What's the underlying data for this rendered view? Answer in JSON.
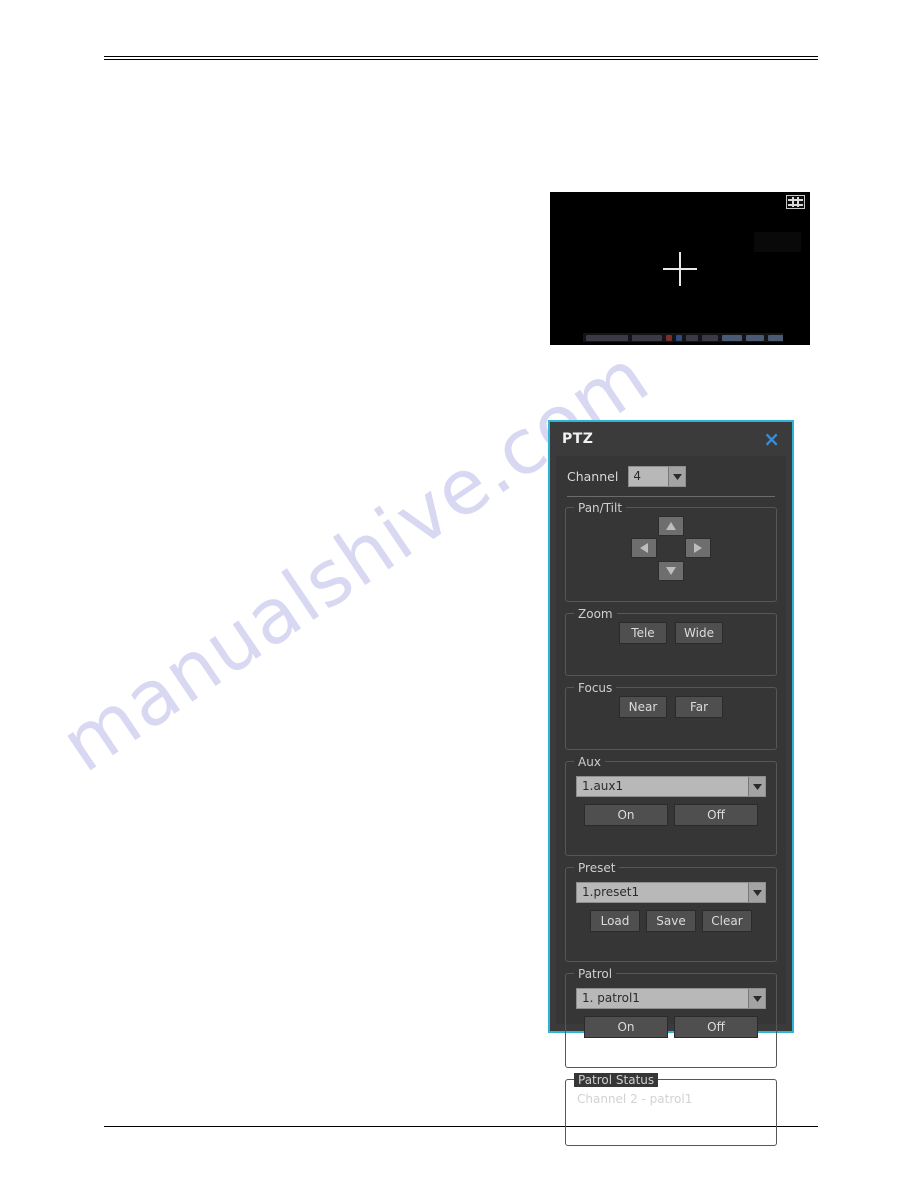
{
  "page": {
    "watermark_text": "manualshive.com",
    "accent_border_color": "#2fb4d6",
    "panel_bg_color": "#363636",
    "close_icon_color": "#2f8fe0"
  },
  "video_preview": {
    "name": "camera-live-view",
    "background_color": "#000000",
    "crosshair_icon": "crosshair-icon",
    "layout_icon": "grid-layout-icon"
  },
  "ptz_dialog": {
    "title": "PTZ",
    "close_label": "×",
    "channel": {
      "label": "Channel",
      "value": "4"
    },
    "pan_tilt": {
      "title": "Pan/Tilt",
      "up": "▲",
      "down": "▼",
      "left": "◀",
      "right": "▶"
    },
    "zoom": {
      "title": "Zoom",
      "tele": "Tele",
      "wide": "Wide"
    },
    "focus": {
      "title": "Focus",
      "near": "Near",
      "far": "Far"
    },
    "aux": {
      "title": "Aux",
      "selected": "1.aux1",
      "on": "On",
      "off": "Off"
    },
    "preset": {
      "title": "Preset",
      "selected": "1.preset1",
      "load": "Load",
      "save": "Save",
      "clear": "Clear"
    },
    "patrol": {
      "title": "Patrol",
      "selected": "1. patrol1",
      "on": "On",
      "off": "Off"
    },
    "patrol_status": {
      "title": "Patrol Status",
      "value": "Channel 2 - patrol1"
    }
  }
}
